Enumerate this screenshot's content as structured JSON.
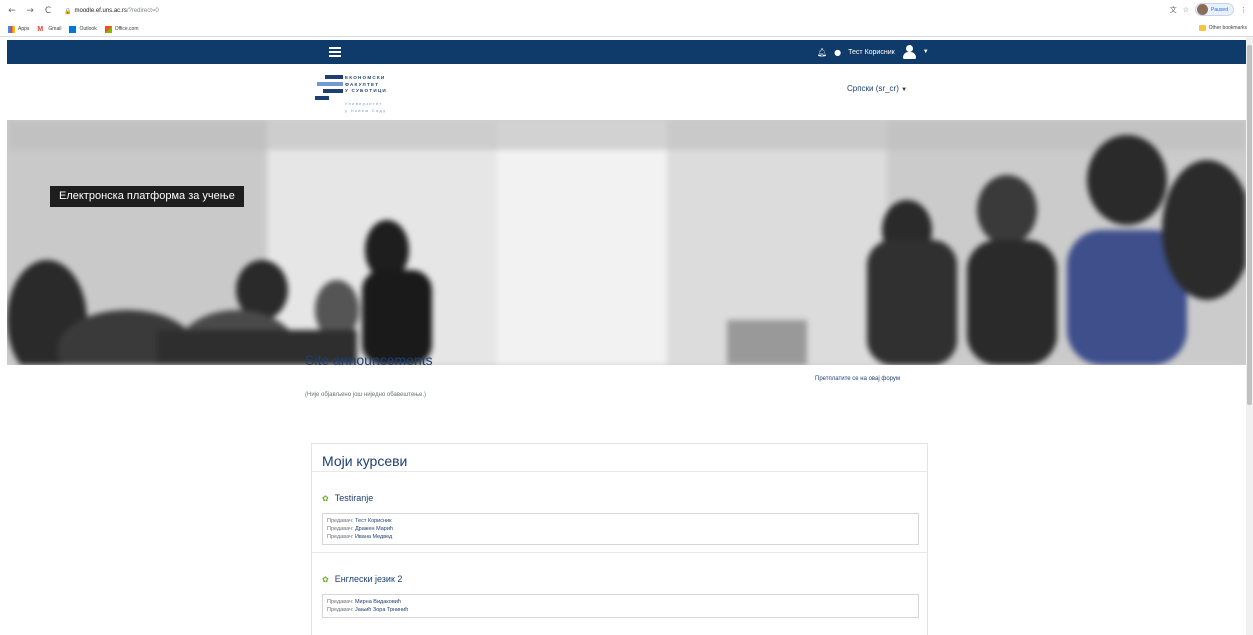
{
  "browser": {
    "url_host": "moodle.ef.uns.ac.rs",
    "url_path": "/?redirect=0",
    "profile_label": "Paused",
    "bookmarks": [
      {
        "label": "Apps"
      },
      {
        "label": "Gmail"
      },
      {
        "label": "Outlook"
      },
      {
        "label": "Office.com"
      }
    ],
    "other_bookmarks": "Other bookmarks"
  },
  "navbar": {
    "user_name": "Тест Корисник",
    "accent_color": "#0f3b6b"
  },
  "brand": {
    "logo_lines": [
      "ЕКОНОМСКИ",
      "ФАКУЛТЕТ",
      "У СУБОТИЦИ"
    ],
    "logo_sub_lines": [
      "Универзитет",
      "у Новом Саду"
    ],
    "language": "Српски (sr_cr)"
  },
  "hero": {
    "title": "Електронска платформа за учење"
  },
  "announcements": {
    "title": "Site announcements",
    "subscribe": "Претплатите се на овај форум",
    "empty": "(Није објављено још ниједно обавештење.)"
  },
  "my_courses": {
    "title": "Моји курсеви",
    "courses": [
      {
        "name": "Testiranje",
        "teachers": [
          {
            "role": "Предавач:",
            "name": "Тест Корисник"
          },
          {
            "role": "Предавач:",
            "name": "Дражен Марић"
          },
          {
            "role": "Предавач:",
            "name": "Ивана Медвед"
          }
        ]
      },
      {
        "name": "Енглески језик 2",
        "teachers": [
          {
            "role": "Предавач:",
            "name": "Мирна Видаковић"
          },
          {
            "role": "Предавач:",
            "name": "Јањић Зора Трнинић"
          }
        ]
      }
    ]
  }
}
